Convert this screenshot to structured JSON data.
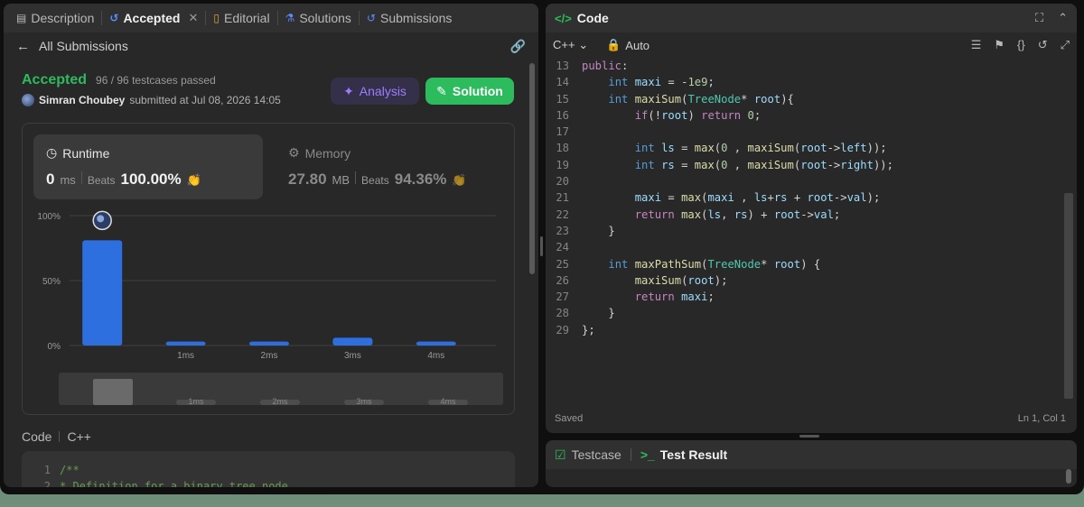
{
  "tabs": [
    {
      "label": "Description",
      "icon": "document-icon"
    },
    {
      "label": "Accepted",
      "icon": "history-icon"
    },
    {
      "label": "Editorial",
      "icon": "book-icon"
    },
    {
      "label": "Solutions",
      "icon": "flask-icon"
    },
    {
      "label": "Submissions",
      "icon": "history-icon"
    }
  ],
  "subbar": {
    "back_label": "All Submissions"
  },
  "result": {
    "status": "Accepted",
    "passed": "96 / 96 testcases passed",
    "submitter": "Simran Choubey",
    "submitted_at": "submitted at Jul 08, 2026 14:05"
  },
  "buttons": {
    "analysis": "Analysis",
    "solution": "Solution"
  },
  "runtime": {
    "label": "Runtime",
    "value": "0",
    "unit": "ms",
    "beats_label": "Beats",
    "beats": "100.00%"
  },
  "memory": {
    "label": "Memory",
    "value": "27.80",
    "unit": "MB",
    "beats_label": "Beats",
    "beats": "94.36%"
  },
  "chart_data": {
    "type": "bar",
    "ylabels": [
      "100%",
      "50%",
      "0%"
    ],
    "ylim": [
      0,
      100
    ],
    "categories": [
      "0ms",
      "1ms",
      "2ms",
      "3ms",
      "4ms"
    ],
    "xlabels": [
      "",
      "1ms",
      "2ms",
      "3ms",
      "4ms"
    ],
    "values": [
      81,
      3,
      3,
      6,
      3
    ],
    "highlight_index": 0,
    "overview_labels": [
      "1ms",
      "2ms",
      "3ms",
      "4ms"
    ]
  },
  "code_section": {
    "label": "Code",
    "lang": "C++"
  },
  "code_preview": [
    {
      "n": "1",
      "text": "/**"
    },
    {
      "n": "2",
      "text": " * Definition for a binary tree node."
    }
  ],
  "editor": {
    "title": "Code",
    "language": "C++",
    "mode": "Auto",
    "status": "Saved",
    "position": "Ln 1, Col 1",
    "lines": [
      {
        "n": "13",
        "text": "public:"
      },
      {
        "n": "14",
        "text": "    int maxi = -1e9;"
      },
      {
        "n": "15",
        "text": "    int maxiSum(TreeNode* root){"
      },
      {
        "n": "16",
        "text": "        if(!root) return 0;"
      },
      {
        "n": "17",
        "text": ""
      },
      {
        "n": "18",
        "text": "        int ls = max(0 , maxiSum(root->left));"
      },
      {
        "n": "19",
        "text": "        int rs = max(0 , maxiSum(root->right));"
      },
      {
        "n": "20",
        "text": ""
      },
      {
        "n": "21",
        "text": "        maxi = max(maxi , ls+rs + root->val);"
      },
      {
        "n": "22",
        "text": "        return max(ls, rs) + root->val;"
      },
      {
        "n": "23",
        "text": "    }"
      },
      {
        "n": "24",
        "text": ""
      },
      {
        "n": "25",
        "text": "    int maxPathSum(TreeNode* root) {"
      },
      {
        "n": "26",
        "text": "        maxiSum(root);"
      },
      {
        "n": "27",
        "text": "        return maxi;"
      },
      {
        "n": "28",
        "text": "    }"
      },
      {
        "n": "29",
        "text": "};"
      }
    ]
  },
  "bottom_tabs": {
    "testcase": "Testcase",
    "test_result": "Test Result"
  },
  "colors": {
    "accepted": "#2cbb5d",
    "bar": "#2e6fe0",
    "analysis": "#9d7dff"
  }
}
